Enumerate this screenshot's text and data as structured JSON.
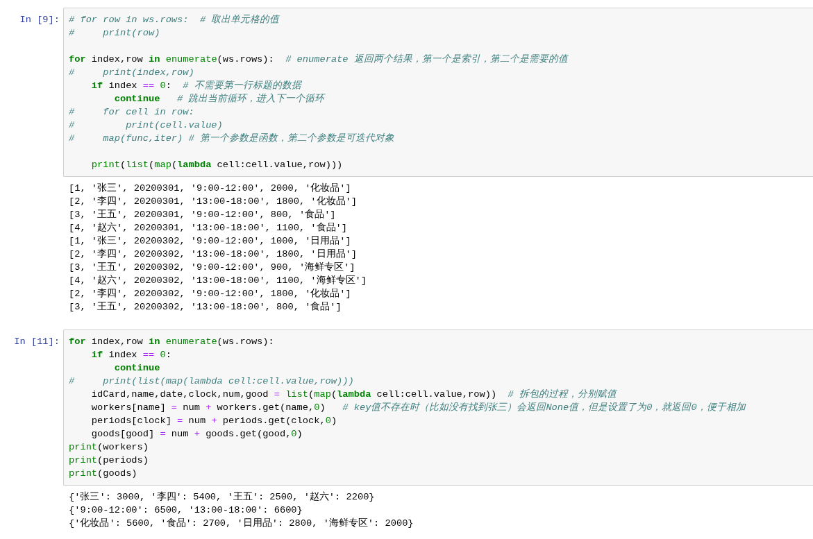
{
  "cells": [
    {
      "prompt": "In [9]:",
      "code_blocks": [
        {
          "lines": [
            [
              {
                "kind": "comment",
                "text": "# for row in ws.rows:  # 取出单元格的值"
              }
            ],
            [
              {
                "kind": "comment",
                "text": "#     print(row)"
              }
            ]
          ]
        },
        {
          "lines": [
            [
              {
                "kind": "keyword",
                "text": "for"
              },
              {
                "kind": "plain",
                "text": " index,row "
              },
              {
                "kind": "keyword",
                "text": "in"
              },
              {
                "kind": "builtin",
                "text": " enumerate"
              },
              {
                "kind": "plain",
                "text": "(ws.rows):  "
              },
              {
                "kind": "comment",
                "text": "# enumerate 返回两个结果，第一个是索引，第二个是需要的值"
              }
            ],
            [
              {
                "kind": "comment",
                "text": "#     print(index,row)"
              }
            ],
            [
              {
                "kind": "keyword",
                "text": "    if"
              },
              {
                "kind": "plain",
                "text": " index "
              },
              {
                "kind": "operator",
                "text": "=="
              },
              {
                "kind": "number",
                "text": " 0"
              },
              {
                "kind": "plain",
                "text": ":  "
              },
              {
                "kind": "comment",
                "text": "# 不需要第一行标题的数据"
              }
            ],
            [
              {
                "kind": "keyword",
                "text": "        continue"
              },
              {
                "kind": "comment",
                "text": "   # 跳出当前循环，进入下一个循环"
              }
            ],
            [
              {
                "kind": "comment",
                "text": "#     for cell in row:"
              }
            ],
            [
              {
                "kind": "comment",
                "text": "#         print(cell.value)"
              }
            ],
            [
              {
                "kind": "comment",
                "text": "#     map(func,iter) # 第一个参数是函数，第二个参数是可迭代对象"
              }
            ]
          ]
        },
        {
          "lines": [
            [
              {
                "kind": "builtin",
                "text": "    print"
              },
              {
                "kind": "plain",
                "text": "("
              },
              {
                "kind": "builtin",
                "text": "list"
              },
              {
                "kind": "plain",
                "text": "("
              },
              {
                "kind": "builtin",
                "text": "map"
              },
              {
                "kind": "plain",
                "text": "("
              },
              {
                "kind": "keyword",
                "text": "lambda"
              },
              {
                "kind": "plain",
                "text": " cell:cell.value,row)))"
              }
            ]
          ]
        }
      ],
      "outputs": [
        "[1, '张三', 20200301, '9:00-12:00', 2000, '化妆品']",
        "[2, '李四', 20200301, '13:00-18:00', 1800, '化妆品']",
        "[3, '王五', 20200301, '9:00-12:00', 800, '食品']",
        "[4, '赵六', 20200301, '13:00-18:00', 1100, '食品']",
        "[1, '张三', 20200302, '9:00-12:00', 1000, '日用品']",
        "[2, '李四', 20200302, '13:00-18:00', 1800, '日用品']",
        "[3, '王五', 20200302, '9:00-12:00', 900, '海鲜专区']",
        "[4, '赵六', 20200302, '13:00-18:00', 1100, '海鲜专区']",
        "[2, '李四', 20200302, '9:00-12:00', 1800, '化妆品']",
        "[3, '王五', 20200302, '13:00-18:00', 800, '食品']"
      ]
    },
    {
      "prompt": "In [11]:",
      "code_blocks": [
        {
          "lines": [
            [
              {
                "kind": "keyword",
                "text": "for"
              },
              {
                "kind": "plain",
                "text": " index,row "
              },
              {
                "kind": "keyword",
                "text": "in"
              },
              {
                "kind": "builtin",
                "text": " enumerate"
              },
              {
                "kind": "plain",
                "text": "(ws.rows):"
              }
            ],
            [
              {
                "kind": "keyword",
                "text": "    if"
              },
              {
                "kind": "plain",
                "text": " index "
              },
              {
                "kind": "operator",
                "text": "=="
              },
              {
                "kind": "number",
                "text": " 0"
              },
              {
                "kind": "plain",
                "text": ":"
              }
            ],
            [
              {
                "kind": "keyword",
                "text": "        continue"
              }
            ],
            [
              {
                "kind": "comment",
                "text": "#     print(list(map(lambda cell:cell.value,row)))"
              }
            ],
            [
              {
                "kind": "plain",
                "text": "    idCard,name,date,clock,num,good "
              },
              {
                "kind": "operator",
                "text": "="
              },
              {
                "kind": "builtin",
                "text": " list"
              },
              {
                "kind": "plain",
                "text": "("
              },
              {
                "kind": "builtin",
                "text": "map"
              },
              {
                "kind": "plain",
                "text": "("
              },
              {
                "kind": "keyword",
                "text": "lambda"
              },
              {
                "kind": "plain",
                "text": " cell:cell.value,row))  "
              },
              {
                "kind": "comment",
                "text": "# 拆包的过程，分别赋值"
              }
            ],
            [
              {
                "kind": "plain",
                "text": "    workers[name] "
              },
              {
                "kind": "operator",
                "text": "="
              },
              {
                "kind": "plain",
                "text": " num "
              },
              {
                "kind": "operator",
                "text": "+"
              },
              {
                "kind": "plain",
                "text": " workers.get(name,"
              },
              {
                "kind": "number",
                "text": "0"
              },
              {
                "kind": "plain",
                "text": ")   "
              },
              {
                "kind": "comment",
                "text": "# key值不存在时（比如没有找到张三）会返回None值，但是设置了为0，就返回0，便于相加"
              }
            ],
            [
              {
                "kind": "plain",
                "text": "    periods[clock] "
              },
              {
                "kind": "operator",
                "text": "="
              },
              {
                "kind": "plain",
                "text": " num "
              },
              {
                "kind": "operator",
                "text": "+"
              },
              {
                "kind": "plain",
                "text": " periods.get(clock,"
              },
              {
                "kind": "number",
                "text": "0"
              },
              {
                "kind": "plain",
                "text": ")"
              }
            ],
            [
              {
                "kind": "plain",
                "text": "    goods[good] "
              },
              {
                "kind": "operator",
                "text": "="
              },
              {
                "kind": "plain",
                "text": " num "
              },
              {
                "kind": "operator",
                "text": "+"
              },
              {
                "kind": "plain",
                "text": " goods.get(good,"
              },
              {
                "kind": "number",
                "text": "0"
              },
              {
                "kind": "plain",
                "text": ")"
              }
            ],
            [
              {
                "kind": "builtin",
                "text": "print"
              },
              {
                "kind": "plain",
                "text": "(workers)"
              }
            ],
            [
              {
                "kind": "builtin",
                "text": "print"
              },
              {
                "kind": "plain",
                "text": "(periods)"
              }
            ],
            [
              {
                "kind": "builtin",
                "text": "print"
              },
              {
                "kind": "plain",
                "text": "(goods)"
              }
            ]
          ]
        }
      ],
      "outputs": [
        "{'张三': 3000, '李四': 5400, '王五': 2500, '赵六': 2200}",
        "{'9:00-12:00': 6500, '13:00-18:00': 6600}",
        "{'化妆品': 5600, '食品': 2700, '日用品': 2800, '海鲜专区': 2000}"
      ]
    }
  ]
}
